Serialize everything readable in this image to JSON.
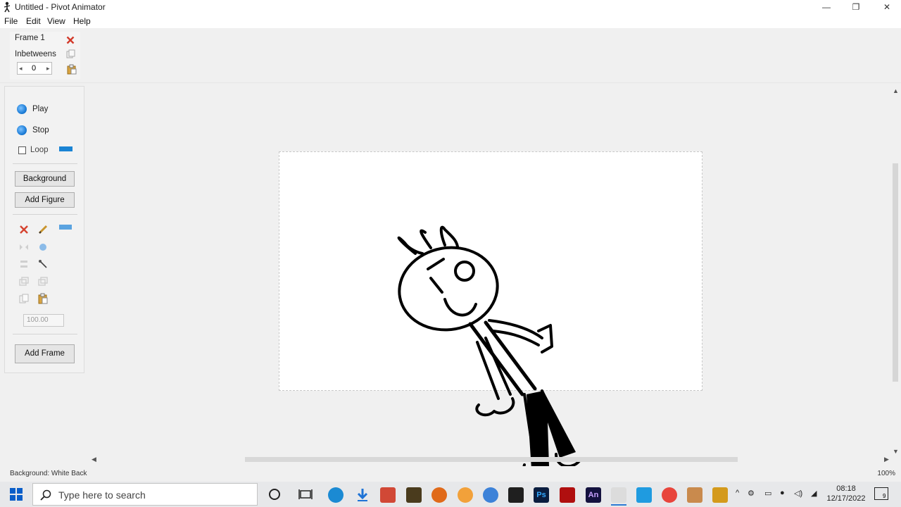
{
  "window": {
    "title": "Untitled - Pivot Animator",
    "minimize": "—",
    "maximize": "❐",
    "close": "✕"
  },
  "menu": {
    "items": [
      "File",
      "Edit",
      "View",
      "Help"
    ]
  },
  "frame_panel": {
    "frame_label": "Frame 1",
    "inbetweens_label": "Inbetweens",
    "inbetweens_value": "0"
  },
  "playback": {
    "play_label": "Play",
    "stop_label": "Stop",
    "loop_label": "Loop",
    "loop_checked": false,
    "accent_color": "#1a84d4"
  },
  "buttons": {
    "background": "Background",
    "add_figure": "Add Figure",
    "add_frame": "Add Frame"
  },
  "figure_tools": {
    "scale_value": "100.00"
  },
  "status": {
    "text": "Background: White Back",
    "zoom": "100%"
  },
  "taskbar": {
    "search_placeholder": "Type here to search",
    "time": "08:18",
    "date": "12/17/2022",
    "notifications": "9"
  }
}
